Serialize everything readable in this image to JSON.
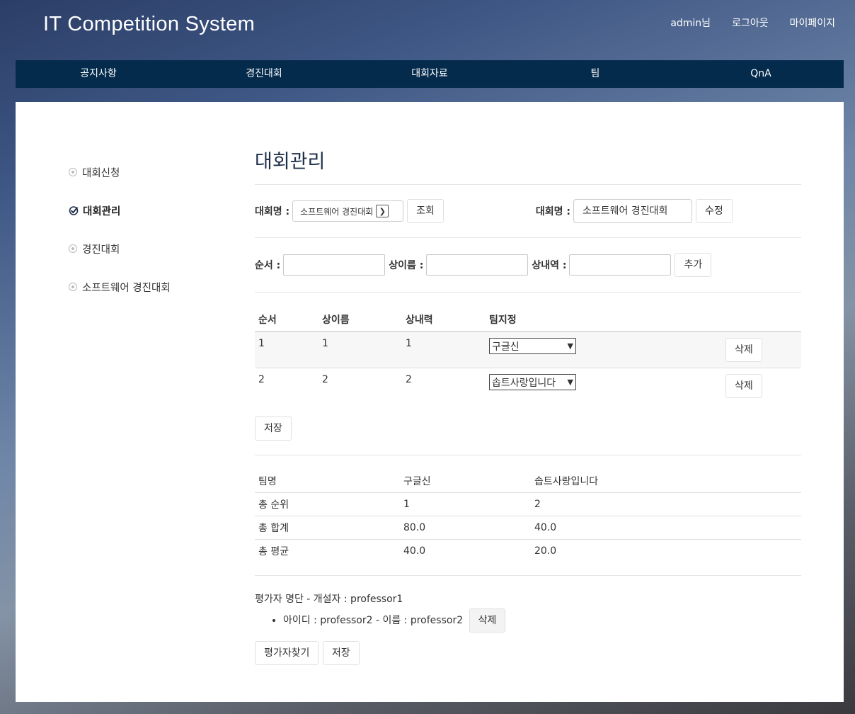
{
  "header": {
    "site_title": "IT Competition System",
    "links": [
      "admin님",
      "로그아웃",
      "마이페이지"
    ]
  },
  "nav": [
    "공지사항",
    "경진대회",
    "대회자료",
    "팀",
    "QnA"
  ],
  "sidebar": {
    "items": [
      {
        "label": "대회신청",
        "active": false
      },
      {
        "label": "대회관리",
        "active": true
      },
      {
        "label": "경진대회",
        "active": false
      },
      {
        "label": "소프트웨어 경진대회",
        "active": false
      }
    ]
  },
  "main": {
    "title": "대회관리",
    "filter": {
      "label": "대회명 :",
      "selected": "소프트웨어 경진대회",
      "search_button": "조회",
      "edit_label": "대회명 :",
      "edit_value": "소프트웨어 경진대회",
      "edit_button": "수정"
    },
    "add_form": {
      "order_label": "순서 :",
      "name_label": "상이름 :",
      "detail_label": "상내역 :",
      "add_button": "추가"
    },
    "prize_table": {
      "headers": [
        "순서",
        "상이름",
        "상내력",
        "팀지정"
      ],
      "rows": [
        {
          "order": "1",
          "name": "1",
          "detail": "1",
          "team": "구글신",
          "delete": "삭제"
        },
        {
          "order": "2",
          "name": "2",
          "detail": "2",
          "team": "솝트사랑입니다",
          "delete": "삭제"
        }
      ],
      "save_button": "저장"
    },
    "result_table": {
      "header": [
        "팀명",
        "구글신",
        "솝트사랑입니다"
      ],
      "rows": [
        [
          "총 순위",
          "1",
          "2"
        ],
        [
          "총 합계",
          "80.0",
          "40.0"
        ],
        [
          "총 평균",
          "40.0",
          "20.0"
        ]
      ]
    },
    "evaluators": {
      "title": "평가자 명단 - 개설자 : professor1",
      "items": [
        {
          "text": "아이디 : professor2 - 이름 : professor2",
          "delete": "삭제"
        }
      ],
      "find_button": "평가자찾기",
      "save_button": "저장"
    }
  }
}
